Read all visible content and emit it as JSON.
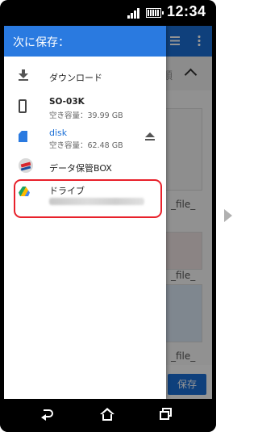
{
  "status_bar": {
    "time": "12:34",
    "icons": [
      "signal-icon",
      "battery-icon"
    ]
  },
  "background": {
    "header_text": "順",
    "captions": [
      "_file_",
      "_file_",
      "_file_"
    ],
    "save_label": "保存"
  },
  "drawer": {
    "title": "次に保存：",
    "items": [
      {
        "name": "ダウンロード",
        "icon": "download-icon"
      },
      {
        "name": "SO-03K",
        "detail": "空き容量：39.99 GB",
        "icon": "phone-icon"
      },
      {
        "name": "disk",
        "detail": "空き容量：62.48 GB",
        "icon": "sd-card-icon",
        "action_icon": "eject-icon"
      },
      {
        "name": "データ保管BOX",
        "icon": "data-box-icon"
      },
      {
        "name": "ドライブ",
        "detail_blurred": true,
        "icon": "google-drive-icon"
      }
    ]
  },
  "colors": {
    "accent": "#2a7ae0",
    "highlight": "#e8212b",
    "sd_label": "#1b6fd6"
  },
  "nav_bar": {
    "icons": [
      "back-icon",
      "home-icon",
      "recent-apps-icon"
    ]
  }
}
